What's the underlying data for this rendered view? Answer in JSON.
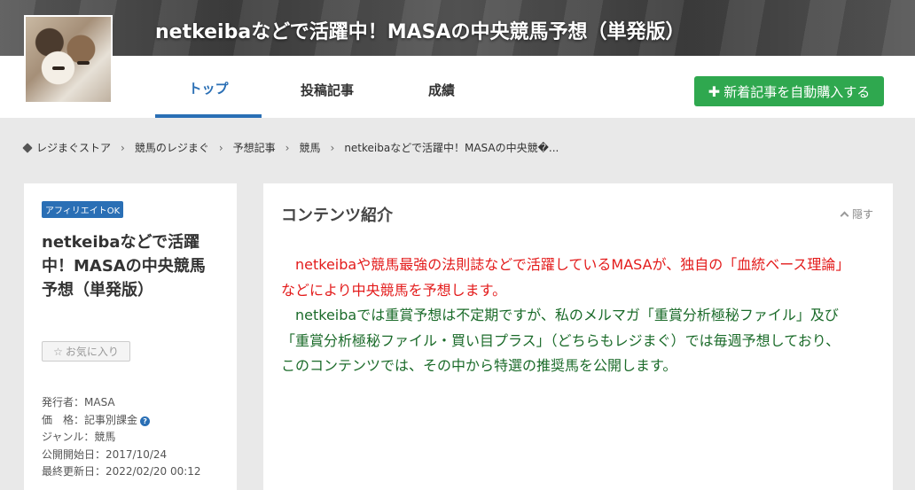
{
  "header": {
    "site_title": "netkeibaなどで活躍中！MASAの中央競馬予想（単発版）"
  },
  "nav": {
    "tabs": [
      {
        "label": "トップ",
        "active": true
      },
      {
        "label": "投稿記事",
        "active": false
      },
      {
        "label": "成績",
        "active": false
      }
    ],
    "auto_buy_label": "新着記事を自動購入する",
    "auto_buy_icon": "plus-icon"
  },
  "breadcrumb": {
    "items": [
      "レジまぐストア",
      "競馬のレジまぐ",
      "予想記事",
      "競馬",
      "netkeibaなどで活躍中！MASAの中央競�..."
    ],
    "separator": "›"
  },
  "sidebar": {
    "badge": "アフィリエイトOK",
    "title": "netkeibaなどで活躍中！MASAの中央競馬予想（単発版）",
    "fav_label": "お気に入り",
    "publisher": "発行者：MASA",
    "price": "価　格：記事別課金",
    "genre": "ジャンル：競馬",
    "start_date": "公開開始日：2017/10/24",
    "updated": "最終更新日：2022/02/20 00:12"
  },
  "content": {
    "heading": "コンテンツ紹介",
    "hide_label": "隠す",
    "lines": [
      {
        "text": "　netkeibaや競馬最強の法則誌などで活躍しているMASAが、独自の「血統ベース理論」",
        "color": "red"
      },
      {
        "text": "などにより中央競馬を予想します。",
        "color": "red"
      },
      {
        "text": "　netkeibaでは重賞予想は不定期ですが、私のメルマガ「重賞分析極秘ファイル」及び",
        "color": "green"
      },
      {
        "text": "「重賞分析極秘ファイル・買い目プラス」（どちらもレジまぐ）では毎週予想しており、",
        "color": "green"
      },
      {
        "text": "このコンテンツでは、その中から特選の推奨馬を公開します。",
        "color": "green"
      }
    ]
  },
  "colors": {
    "accent_blue": "#2a6fb5",
    "buy_green": "#2fa84f",
    "text_red": "#e31b1b",
    "text_green": "#1b6b2a"
  }
}
